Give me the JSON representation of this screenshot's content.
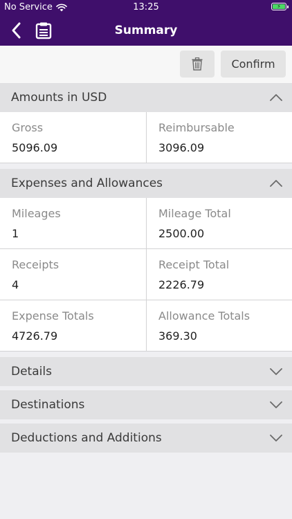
{
  "status": {
    "carrier": "No Service",
    "time": "13:25",
    "battery_glyph": "⚡"
  },
  "nav": {
    "title": "Summary"
  },
  "toolbar": {
    "confirm_label": "Confirm"
  },
  "amounts": {
    "title": "Amounts in USD",
    "gross_label": "Gross",
    "gross_value": "5096.09",
    "reimbursable_label": "Reimbursable",
    "reimbursable_value": "3096.09"
  },
  "expenses": {
    "title": "Expenses and Allowances",
    "mileages_label": "Mileages",
    "mileages_value": "1",
    "mileage_total_label": "Mileage Total",
    "mileage_total_value": "2500.00",
    "receipts_label": "Receipts",
    "receipts_value": "4",
    "receipt_total_label": "Receipt Total",
    "receipt_total_value": "2226.79",
    "expense_totals_label": "Expense Totals",
    "expense_totals_value": "4726.79",
    "allowance_totals_label": "Allowance Totals",
    "allowance_totals_value": "369.30"
  },
  "collapsed": {
    "details": "Details",
    "destinations": "Destinations",
    "deductions": "Deductions and Additions"
  },
  "colors": {
    "brand": "#3f0f6b",
    "header_bg": "#e1e1e3"
  },
  "icons": {
    "back": "chevron-left-icon",
    "clipboard": "clipboard-icon",
    "delete": "trash-icon",
    "expanded": "chevron-up-icon",
    "collapsed": "chevron-down-icon"
  }
}
